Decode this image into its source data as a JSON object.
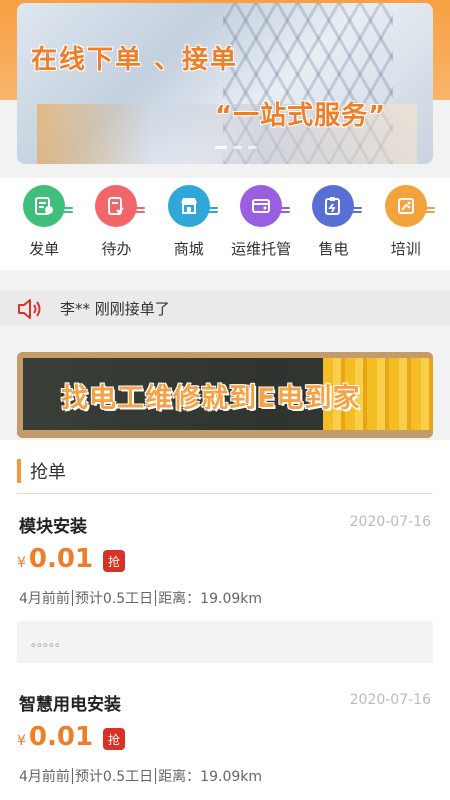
{
  "banner": {
    "title_line1": "在线下单 、接单",
    "title_line2": "“一站式服务”"
  },
  "nav": {
    "items": [
      {
        "label": "发单",
        "icon": "publish-order-icon",
        "color": "#3fbf7b"
      },
      {
        "label": "待办",
        "icon": "todo-list-icon",
        "color": "#f2666a"
      },
      {
        "label": "商城",
        "icon": "store-icon",
        "color": "#2fa7d8"
      },
      {
        "label": "运维托管",
        "icon": "maintenance-hosting-icon",
        "color": "#9a5fe0"
      },
      {
        "label": "售电",
        "icon": "electricity-sale-icon",
        "color": "#5a6fd6"
      },
      {
        "label": "培训",
        "icon": "training-icon",
        "color": "#f4a23b"
      }
    ]
  },
  "notice": {
    "text": "李** 刚刚接单了"
  },
  "sub_banner": {
    "text": "找电工维修就到E电到家"
  },
  "section": {
    "title": "抢单"
  },
  "orders": [
    {
      "name": "模块安装",
      "date": "2020-07-16",
      "currency": "¥",
      "price": "0.01",
      "grab_label": "抢",
      "meta_time": "4月前前",
      "meta_workday": "预计0.5工日",
      "meta_distance": "距离：19.09km",
      "desc": "。。。。。"
    },
    {
      "name": "智慧用电安装",
      "date": "2020-07-16",
      "currency": "¥",
      "price": "0.01",
      "grab_label": "抢",
      "meta_time": "4月前前",
      "meta_workday": "预计0.5工日",
      "meta_distance": "距离：19.09km"
    }
  ],
  "colors": {
    "accent": "#f07d28",
    "grab": "#d83226"
  }
}
